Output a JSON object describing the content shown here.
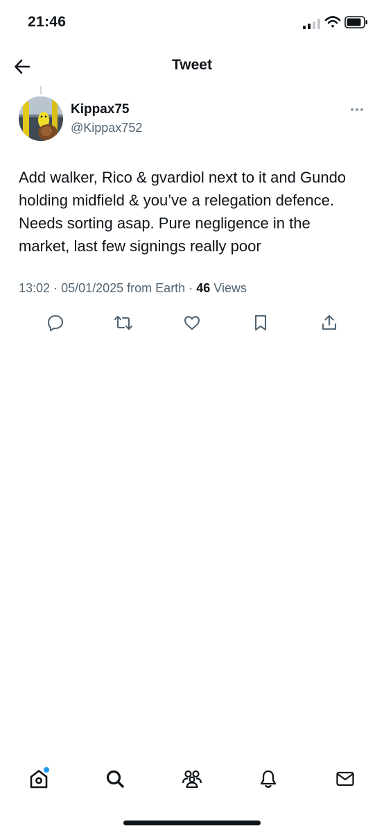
{
  "status_bar": {
    "time": "21:46"
  },
  "header": {
    "title": "Tweet"
  },
  "tweet": {
    "display_name": "Kippax75",
    "handle": "@Kippax752",
    "text": "Add walker, Rico & gvardiol next to it and Gundo holding midfield & you’ve a relegation defence. Needs sorting asap. Pure negligence in the market, last few signings really poor",
    "time": "13:02",
    "date": "05/01/2025",
    "source": "from Earth",
    "views_count": "46",
    "views_label": "Views"
  },
  "actions": [
    {
      "icon": "reply-icon"
    },
    {
      "icon": "retweet-icon"
    },
    {
      "icon": "like-icon"
    },
    {
      "icon": "bookmark-icon"
    },
    {
      "icon": "share-icon"
    }
  ],
  "tabbar": [
    {
      "icon": "home-icon",
      "has_notification_dot": true
    },
    {
      "icon": "search-icon"
    },
    {
      "icon": "communities-icon"
    },
    {
      "icon": "notifications-icon"
    },
    {
      "icon": "messages-icon"
    }
  ],
  "colors": {
    "text_primary": "#0f1419",
    "text_secondary": "#536471",
    "accent": "#1d9bf0"
  }
}
